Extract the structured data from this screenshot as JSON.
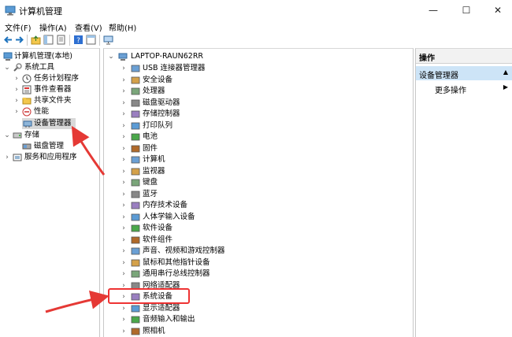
{
  "window": {
    "title": "计算机管理",
    "controls": {
      "minimize": "—",
      "maximize": "☐",
      "close": "✕"
    }
  },
  "menu": [
    "文件(F)",
    "操作(A)",
    "查看(V)",
    "帮助(H)"
  ],
  "left_tree": {
    "root": "计算机管理(本地)",
    "items": [
      {
        "label": "系统工具",
        "icon": "tools-icon"
      },
      {
        "label": "任务计划程序",
        "icon": "clock-icon"
      },
      {
        "label": "事件查看器",
        "icon": "event-viewer-icon"
      },
      {
        "label": "共享文件夹",
        "icon": "shared-folder-icon"
      },
      {
        "label": "性能",
        "icon": "performance-icon"
      },
      {
        "label": "设备管理器",
        "icon": "device-manager-icon"
      },
      {
        "label": "存储",
        "icon": "storage-icon"
      },
      {
        "label": "磁盘管理",
        "icon": "disk-management-icon"
      },
      {
        "label": "服务和应用程序",
        "icon": "services-icon"
      }
    ]
  },
  "device_tree": {
    "computer": "LAPTOP-RAUN62RR",
    "categories": [
      "USB 连接器管理器",
      "安全设备",
      "处理器",
      "磁盘驱动器",
      "存储控制器",
      "打印队列",
      "电池",
      "固件",
      "计算机",
      "监视器",
      "键盘",
      "蓝牙",
      "内存技术设备",
      "人体学输入设备",
      "软件设备",
      "软件组件",
      "声音、视频和游戏控制器",
      "鼠标和其他指针设备",
      "通用串行总线控制器",
      "网络适配器",
      "系统设备",
      "显示适配器",
      "音频输入和输出",
      "照相机"
    ]
  },
  "actions": {
    "title": "操作",
    "group": "设备管理器",
    "more": "更多操作"
  },
  "colors": {
    "selection": "#d9d9d9",
    "action_group": "#cde4f7",
    "annotation_red": "#e53935"
  }
}
